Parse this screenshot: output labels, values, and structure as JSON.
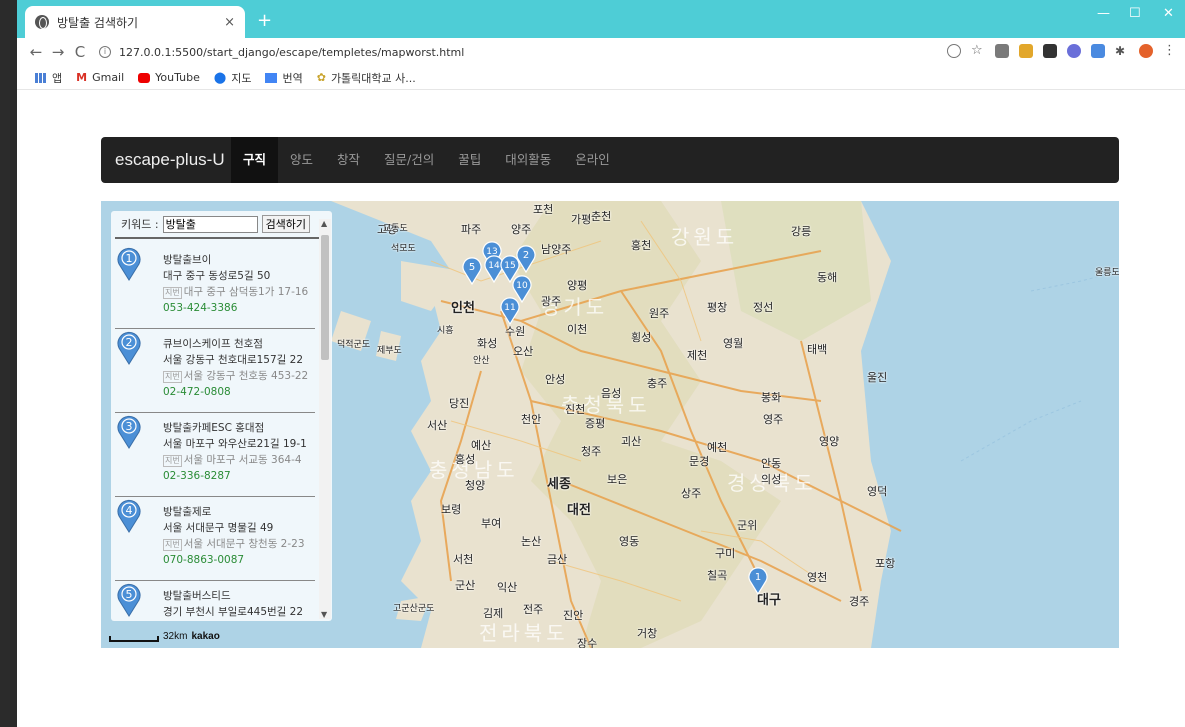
{
  "browser": {
    "tab_title": "방탈출 검색하기",
    "tab_close": "×",
    "new_tab": "+",
    "url": "127.0.0.1:5500/start_django/escape/templetes/mapworst.html",
    "nav_back": "←",
    "nav_forward": "→",
    "nav_reload": "C",
    "window_min": "—",
    "window_max": "☐",
    "window_close": "✕",
    "bookmarks": [
      "앱",
      "Gmail",
      "YouTube",
      "지도",
      "번역",
      "가톨릭대학교 사..."
    ]
  },
  "navbar": {
    "brand": "escape-plus-U",
    "items": [
      "구직",
      "양도",
      "창작",
      "질문/건의",
      "꿀팁",
      "대외활동",
      "온라인"
    ],
    "active_index": 0
  },
  "search": {
    "label": "키워드 :",
    "value": "방탈출",
    "button": "검색하기"
  },
  "results": [
    {
      "num": "1",
      "name": "방탈출브이",
      "road": "대구 중구 동성로5길 50",
      "jibun_tag": "지번",
      "jibun": "대구 중구 삼덕동1가 17-16",
      "tel": "053-424-3386"
    },
    {
      "num": "2",
      "name": "큐브이스케이프 천호점",
      "road": "서울 강동구 천호대로157길 22",
      "jibun_tag": "지번",
      "jibun": "서울 강동구 천호동 453-22",
      "tel": "02-472-0808"
    },
    {
      "num": "3",
      "name": "방탈출카페ESC 홍대점",
      "road": "서울 마포구 와우산로21길 19-1",
      "jibun_tag": "지번",
      "jibun": "서울 마포구 서교동 364-4",
      "tel": "02-336-8287"
    },
    {
      "num": "4",
      "name": "방탈출제로",
      "road": "서울 서대문구 명물길 49",
      "jibun_tag": "지번",
      "jibun": "서울 서대문구 창천동 2-23",
      "tel": "070-8863-0087"
    },
    {
      "num": "5",
      "name": "방탈출버스티드",
      "road": "경기 부천시 부일로445번길 22",
      "jibun_tag": "",
      "jibun": "",
      "tel": ""
    }
  ],
  "map": {
    "scale": "32km",
    "provider": "kakao",
    "cities": [
      "포천",
      "춘천",
      "파주",
      "양주",
      "가평",
      "강릉",
      "고양",
      "남양주",
      "홍천",
      "동해",
      "인천",
      "광주",
      "양평",
      "원주",
      "평창",
      "정선",
      "이천",
      "횡성",
      "화성",
      "오산",
      "제천",
      "영월",
      "태백",
      "안성",
      "충주",
      "당진",
      "음성",
      "봉화",
      "울진",
      "서산",
      "천안",
      "진천",
      "증평",
      "영주",
      "예산",
      "청주",
      "괴산",
      "예천",
      "영양",
      "홍성",
      "문경",
      "안동",
      "세종",
      "보은",
      "청양",
      "상주",
      "의성",
      "영덕",
      "보령",
      "대전",
      "군위",
      "부여",
      "논산",
      "영동",
      "구미",
      "포항",
      "서천",
      "금산",
      "칠곡",
      "영천",
      "군산",
      "익산",
      "대구",
      "경주",
      "김제",
      "전주",
      "진안",
      "거창",
      "장수",
      "울릉도",
      "덕적군도",
      "제부도",
      "고군산군도",
      "석모도",
      "교동도",
      "시흥",
      "수원",
      "안산"
    ],
    "provinces": [
      "강원도",
      "경기도",
      "충청북도",
      "충청남도",
      "경상북도",
      "전라북도"
    ],
    "markers": [
      "1",
      "2",
      "5",
      "10",
      "11",
      "13",
      "14",
      "15"
    ]
  },
  "colors": {
    "tabbar": "#4ecdd6",
    "navbar": "#222222",
    "tel": "#2a8c36",
    "pin": "#4b8fd6"
  }
}
